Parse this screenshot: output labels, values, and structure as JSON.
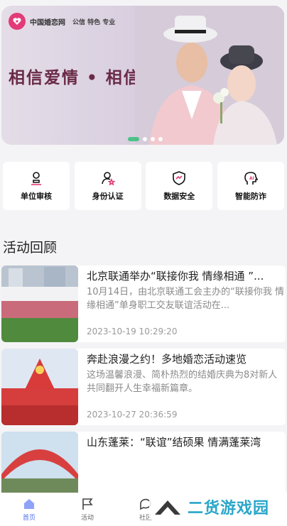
{
  "banner": {
    "brand_name": "中国婚恋网",
    "brand_tag": "公信 特色 专业",
    "slogan": "相信爱情 • 相信我们",
    "slides": 4,
    "active_slide": 1
  },
  "features": [
    {
      "label": "单位审核",
      "icon": "user-stamp-icon"
    },
    {
      "label": "身份认证",
      "icon": "user-star-icon"
    },
    {
      "label": "数据安全",
      "icon": "shield-chart-icon"
    },
    {
      "label": "智能防诈",
      "icon": "ai-head-icon"
    }
  ],
  "section_title": "活动回顾",
  "news": [
    {
      "title": "北京联通举办“联接你我 情缘相通 ”...",
      "desc": "10月14日，由北京联通工会主办的“联接你我 情缘相通”单身职工交友联谊活动在...",
      "time": "2023-10-19 10:29:20"
    },
    {
      "title": "奔赴浪漫之约！多地婚恋活动速览",
      "desc": "这场温馨浪漫、简朴热烈的结婚庆典为8对新人共同翻开人生幸福新篇章。",
      "time": "2023-10-27 20:36:59"
    },
    {
      "title": "山东蓬莱：“联谊”结硕果 情满蓬莱湾",
      "desc": "",
      "time": ""
    }
  ],
  "tabs": [
    {
      "label": "首页",
      "icon": "home-icon",
      "active": true
    },
    {
      "label": "活动",
      "icon": "flag-icon",
      "active": false
    },
    {
      "label": "社区",
      "icon": "chat-icon",
      "active": false
    }
  ],
  "watermark": "二货游戏园",
  "colors": {
    "accent": "#4b6ef5",
    "brand": "#e23b78",
    "indicator": "#3cc07f"
  }
}
